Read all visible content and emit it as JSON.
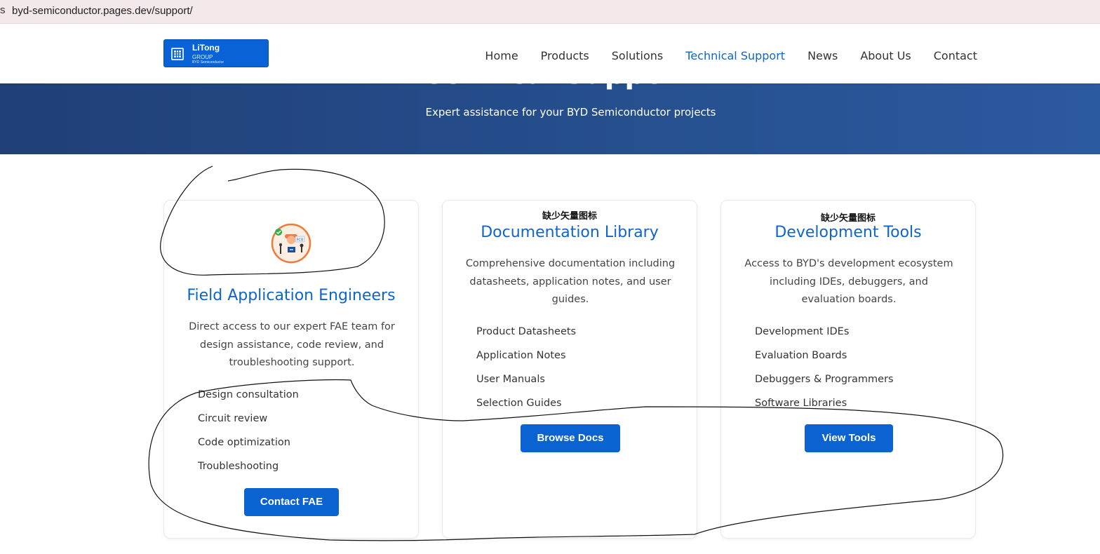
{
  "browser": {
    "edge_glyph": "s",
    "url": "byd-semiconductor.pages.dev/support/"
  },
  "logo": {
    "name": "LiTong",
    "group": "GROUP",
    "sub": "BYD Semiconductor"
  },
  "nav": {
    "items": [
      "Home",
      "Products",
      "Solutions",
      "Technical Support",
      "News",
      "About Us",
      "Contact"
    ],
    "active": "Technical Support"
  },
  "hero": {
    "title": "Technical Support",
    "subtitle": "Expert assistance for your BYD Semiconductor projects"
  },
  "cards": [
    {
      "icon": "fae-engineer-icon",
      "icon_badge_text": "PCB",
      "title": "Field Application Engineers",
      "description": "Direct access to our expert FAE team for design assistance, code review, and troubleshooting support.",
      "items": [
        "Design consultation",
        "Circuit review",
        "Code optimization",
        "Troubleshooting"
      ],
      "button": "Contact FAE"
    },
    {
      "missing_icon_text": "缺少矢量图标",
      "title": "Documentation Library",
      "description": "Comprehensive documentation including datasheets, application notes, and user guides.",
      "items": [
        "Product Datasheets",
        "Application Notes",
        "User Manuals",
        "Selection Guides"
      ],
      "button": "Browse Docs"
    },
    {
      "missing_icon_text": "缺少矢量图标",
      "title": "Development Tools",
      "description": "Access to BYD's development ecosystem including IDEs, debuggers, and evaluation boards.",
      "items": [
        "Development IDEs",
        "Evaluation Boards",
        "Debuggers & Programmers",
        "Software Libraries"
      ],
      "button": "View Tools"
    }
  ],
  "colors": {
    "accent": "#0d66c8",
    "button": "#0a63d0",
    "hero": "#26508f",
    "icon_ring": "#f07a3a"
  }
}
